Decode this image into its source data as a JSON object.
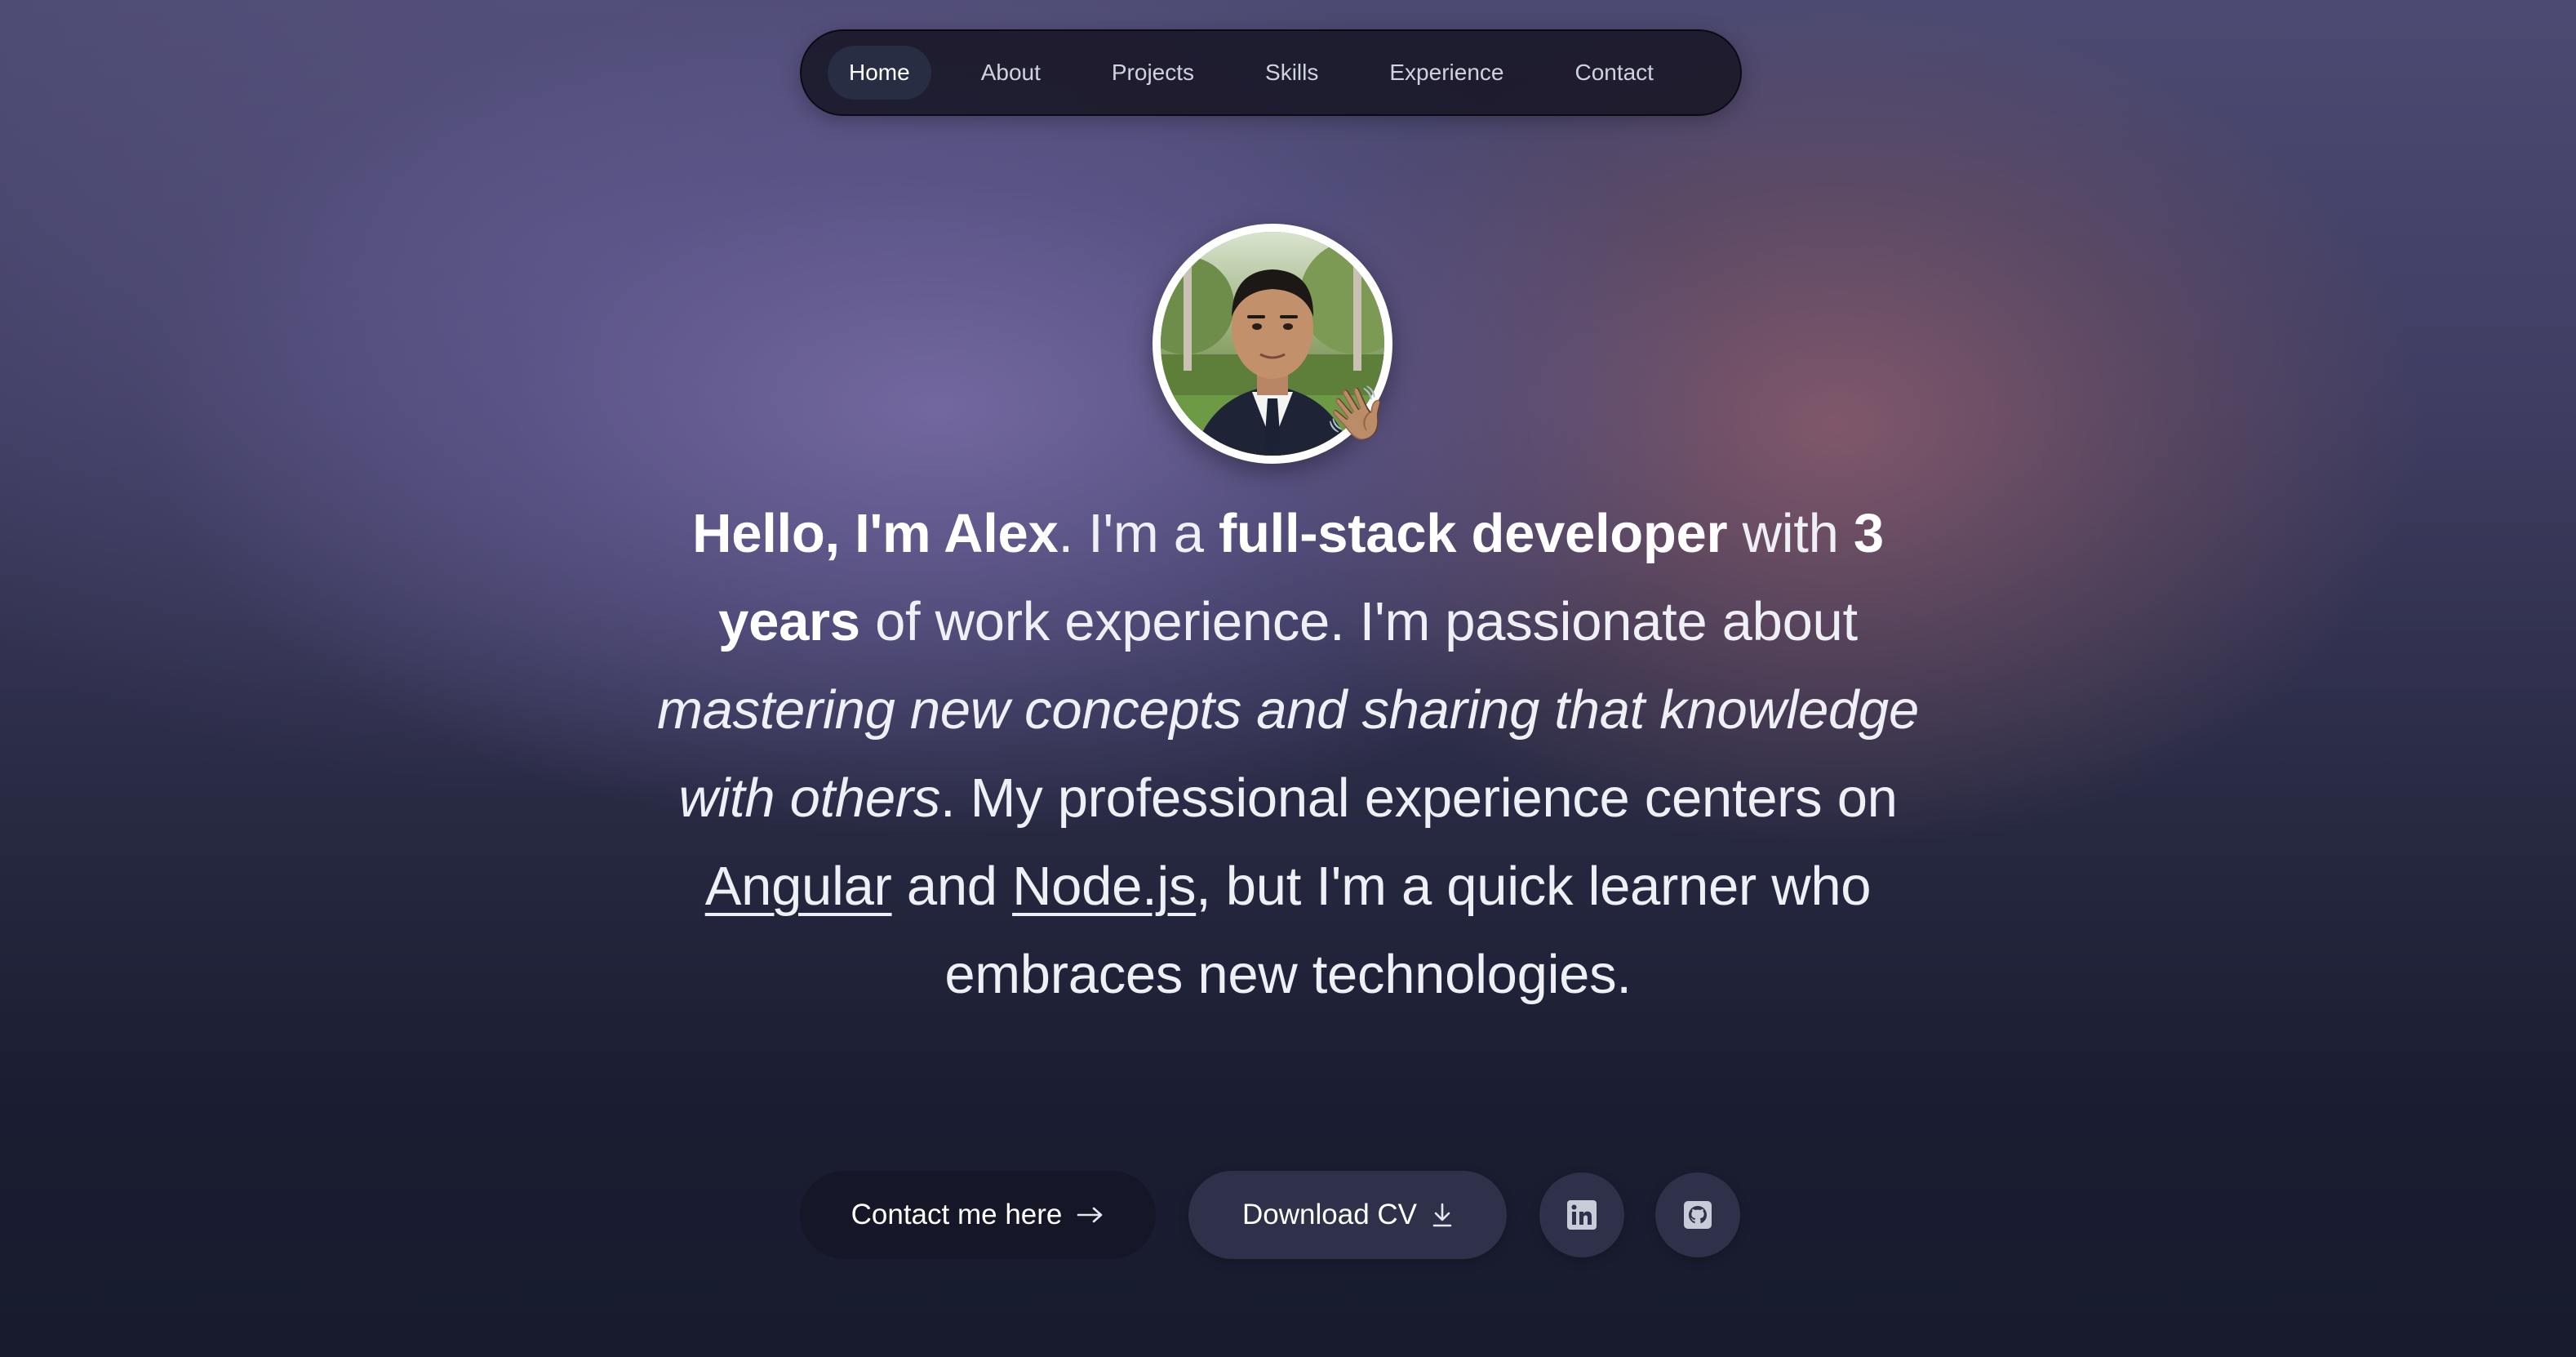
{
  "nav": {
    "items": [
      {
        "label": "Home",
        "active": true
      },
      {
        "label": "About",
        "active": false
      },
      {
        "label": "Projects",
        "active": false
      },
      {
        "label": "Skills",
        "active": false
      },
      {
        "label": "Experience",
        "active": false
      },
      {
        "label": "Contact",
        "active": false
      }
    ]
  },
  "hero": {
    "avatar_icon": "profile-photo",
    "wave_emoji": "👋🏽",
    "intro": {
      "greeting": "Hello, I'm Alex",
      "t1": ". I'm a ",
      "role": "full-stack developer",
      "t2": " with ",
      "years": "3 years",
      "t3": " of work experience. I'm passionate about ",
      "passion": "mastering new concepts and sharing that knowledge with others",
      "t4": ". My professional experience centers on ",
      "tech1": "Angular",
      "t5": " and ",
      "tech2": "Node.js",
      "t6": ", but I'm a quick learner who embraces new technologies."
    }
  },
  "actions": {
    "contact_label": "Contact me here",
    "contact_icon": "arrow-right-icon",
    "cv_label": "Download CV",
    "cv_icon": "download-icon",
    "linkedin_icon": "linkedin-icon",
    "github_icon": "github-icon"
  },
  "colors": {
    "nav_bg": "#18162a",
    "nav_active_bg": "#283046",
    "contact_btn_bg": "#151728",
    "secondary_btn_bg": "#2e3149",
    "text": "#eef0f6"
  }
}
